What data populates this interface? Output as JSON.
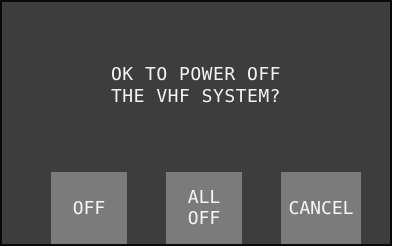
{
  "dialog": {
    "message_line1": "OK TO POWER OFF",
    "message_line2": "THE VHF SYSTEM?"
  },
  "buttons": {
    "off_label": "OFF",
    "all_off_line1": "ALL",
    "all_off_line2": "OFF",
    "cancel_label": "CANCEL"
  },
  "colors": {
    "dialog_background": "#3d3d3d",
    "button_background": "#7b7b7b",
    "text": "#f2f2f2"
  }
}
